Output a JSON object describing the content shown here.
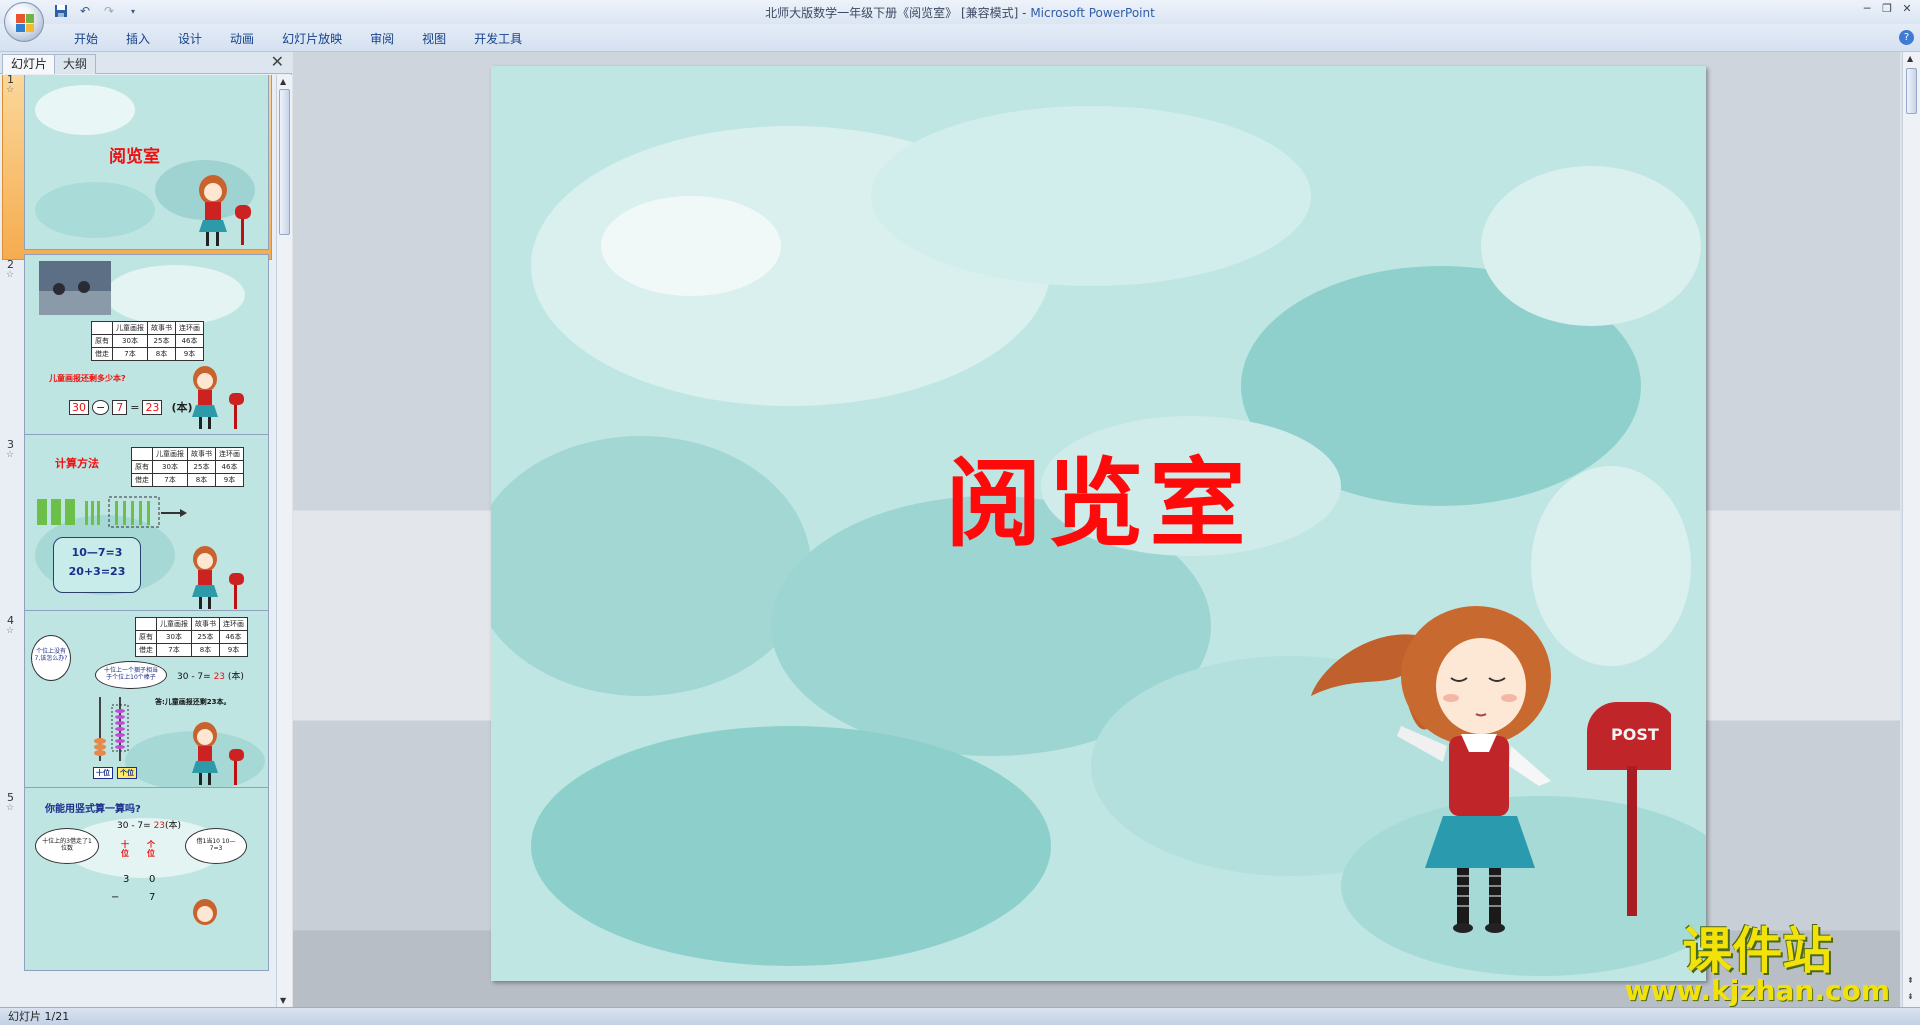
{
  "window": {
    "title": "北师大版数学一年级下册《阅览室》 [兼容模式] - ",
    "app_name": "Microsoft PowerPoint",
    "controls": [
      "─",
      "❐",
      "✕"
    ]
  },
  "ribbon": {
    "tabs": [
      "开始",
      "插入",
      "设计",
      "动画",
      "幻灯片放映",
      "审阅",
      "视图",
      "开发工具"
    ],
    "help": "?"
  },
  "pane": {
    "tabs": [
      "幻灯片",
      "大纲"
    ],
    "close": "✕"
  },
  "thumbnails": [
    {
      "num": "1",
      "title": "阅览室"
    },
    {
      "num": "2",
      "table": {
        "headers": [
          "",
          "儿童画报",
          "故事书",
          "连环画"
        ],
        "rows": [
          [
            "原有",
            "30本",
            "25本",
            "46本"
          ],
          [
            "借走",
            "7本",
            "8本",
            "9本"
          ]
        ]
      },
      "question": "儿童画报还剩多少本?",
      "equation": [
        "30",
        "−",
        "7",
        "=",
        "23",
        "(本)"
      ]
    },
    {
      "num": "3",
      "heading": "计算方法",
      "table": {
        "headers": [
          "",
          "儿童画报",
          "故事书",
          "连环画"
        ],
        "rows": [
          [
            "原有",
            "30本",
            "25本",
            "46本"
          ],
          [
            "借走",
            "7本",
            "8本",
            "9本"
          ]
        ]
      },
      "calc": [
        "10—7=3",
        "20+3=23"
      ]
    },
    {
      "num": "4",
      "table": {
        "headers": [
          "",
          "儿童画报",
          "故事书",
          "连环画"
        ],
        "rows": [
          [
            "原有",
            "30本",
            "25本",
            "46本"
          ],
          [
            "借走",
            "7本",
            "8本",
            "9本"
          ]
        ]
      },
      "bubble1": "个位上没有7,该怎么办?",
      "bubble2": "十位上一个捆子相当于个位上10个棒子",
      "equation": "30 - 7= ",
      "answer_num": "23",
      "unit": "(本)",
      "answer": "答:儿童画报还剩23本。",
      "labels": [
        "十位",
        "个位"
      ]
    },
    {
      "num": "5",
      "heading": "你能用竖式算一算吗?",
      "equation": "30 - 7= ",
      "answer_num": "23",
      "unit": "(本)",
      "bubble1": "十位上的3借走了1位数",
      "bubble2": "借1当10 10—7=3",
      "col_labels": [
        "十位",
        "个位"
      ],
      "digits": [
        "3",
        "0",
        "−",
        "7"
      ]
    }
  ],
  "slide": {
    "title": "阅览室"
  },
  "status": {
    "text": "幻灯片 1/21"
  },
  "watermark": {
    "cn": "课件站",
    "url": "www.kjzhan.com"
  },
  "colors": {
    "slide_bg": "#c3e8e5",
    "title_red": "#ff0a0a",
    "selection": "#f6a54a"
  }
}
